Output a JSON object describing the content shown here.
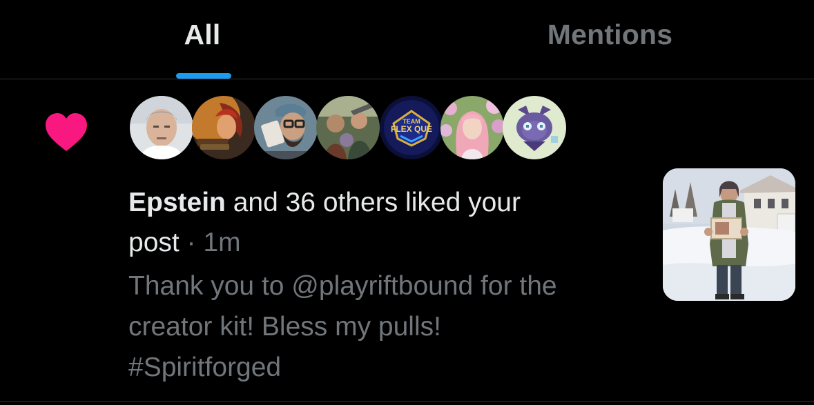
{
  "tabs": [
    {
      "label": "All",
      "selected": true
    },
    {
      "label": "Mentions",
      "selected": false
    }
  ],
  "colors": {
    "background": "#000000",
    "text_primary": "#e7e9ea",
    "text_secondary": "#71767b",
    "accent": "#1d9bf0",
    "like": "#f91880",
    "divider": "#2f3336"
  },
  "notification": {
    "type_icon": "heart-icon",
    "avatars": [
      {
        "name": "avatar-1"
      },
      {
        "name": "avatar-2"
      },
      {
        "name": "avatar-3"
      },
      {
        "name": "avatar-4"
      },
      {
        "name": "avatar-5",
        "text_line1": "TEAM",
        "text_line2": "FLEX QUE"
      },
      {
        "name": "avatar-6"
      },
      {
        "name": "avatar-7"
      }
    ],
    "actor_name": "Epstein",
    "action_text": " and 36 others liked your post",
    "separator": " · ",
    "time": "1m",
    "post_lines": [
      "Thank you to @playriftbound for the",
      "creator kit! Bless my pulls!",
      "#Spiritforged"
    ]
  }
}
